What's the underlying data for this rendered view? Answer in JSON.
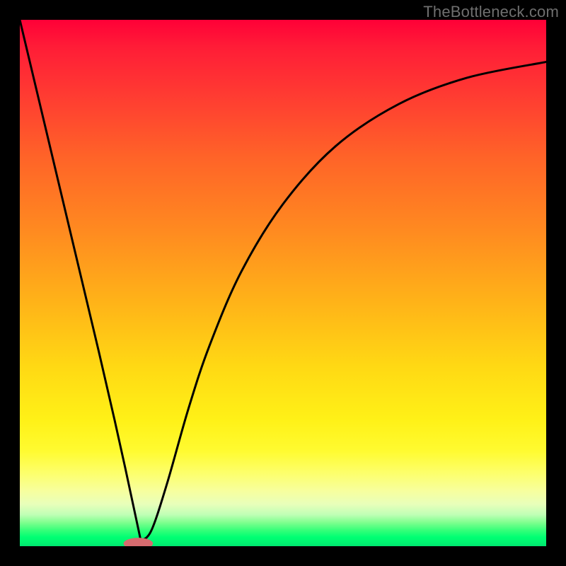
{
  "attribution": "TheBottleneck.com",
  "chart_data": {
    "type": "line",
    "title": "",
    "xlabel": "",
    "ylabel": "",
    "xlim": [
      0,
      100
    ],
    "ylim": [
      0,
      100
    ],
    "series": [
      {
        "name": "bottleneck-curve",
        "x": [
          0,
          5,
          10,
          15,
          18,
          20,
          21.5,
          23,
          25,
          28,
          32,
          36,
          42,
          50,
          60,
          72,
          85,
          100
        ],
        "y": [
          100,
          79,
          58,
          37,
          24,
          15,
          8,
          1,
          3,
          12,
          26,
          38,
          52,
          65,
          76,
          84,
          89,
          92
        ]
      }
    ],
    "marker": {
      "x": 22.5,
      "y": 0.5,
      "rx": 2.8,
      "ry": 1.1
    },
    "background_gradient": {
      "top": "#ff0037",
      "mid_upper": "#ff8a20",
      "mid": "#fff117",
      "mid_lower": "#c0ffb6",
      "bottom": "#00e570"
    }
  }
}
